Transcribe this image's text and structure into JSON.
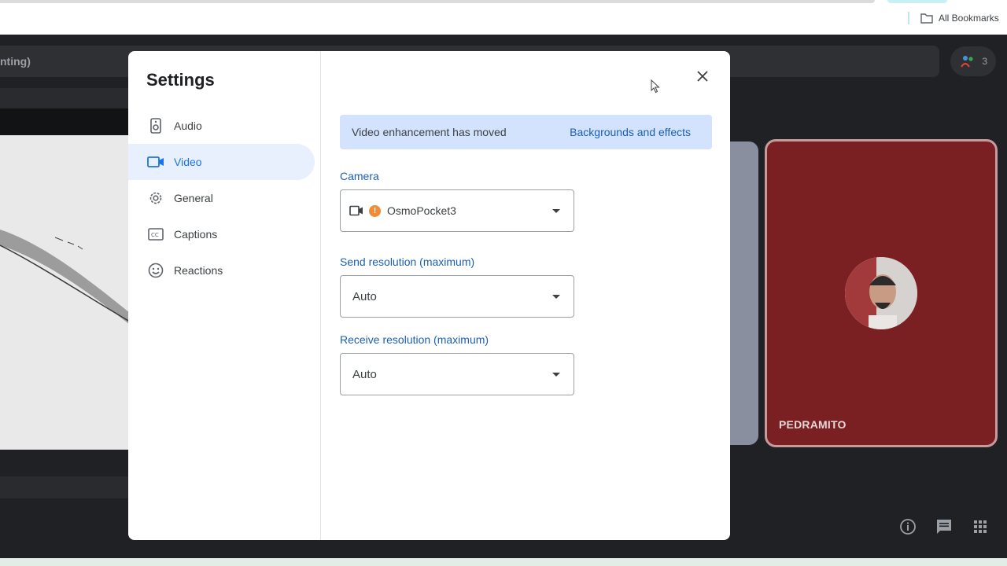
{
  "browser": {
    "bookmarks_label": "All Bookmarks"
  },
  "meeting": {
    "title_fragment": "nting)",
    "participant_count": "3",
    "participant_name": "PEDRAMITO"
  },
  "settings": {
    "title": "Settings",
    "nav": [
      {
        "label": "Audio",
        "icon": "speaker-icon",
        "active": false
      },
      {
        "label": "Video",
        "icon": "video-camera-icon",
        "active": true
      },
      {
        "label": "General",
        "icon": "gear-icon",
        "active": false
      },
      {
        "label": "Captions",
        "icon": "captions-icon",
        "active": false
      },
      {
        "label": "Reactions",
        "icon": "smiley-icon",
        "active": false
      }
    ],
    "banner": {
      "text": "Video enhancement has moved",
      "link": "Backgrounds and effects"
    },
    "camera": {
      "label": "Camera",
      "value": "OsmoPocket3",
      "warning_glyph": "!"
    },
    "send_resolution": {
      "label": "Send resolution (maximum)",
      "value": "Auto"
    },
    "receive_resolution": {
      "label": "Receive resolution (maximum)",
      "value": "Auto"
    }
  },
  "colors": {
    "accent": "#1a73e8",
    "banner_bg": "#d3e3fd",
    "active_nav_bg": "#e8f0fe",
    "tile_bg": "#7a1f22"
  }
}
